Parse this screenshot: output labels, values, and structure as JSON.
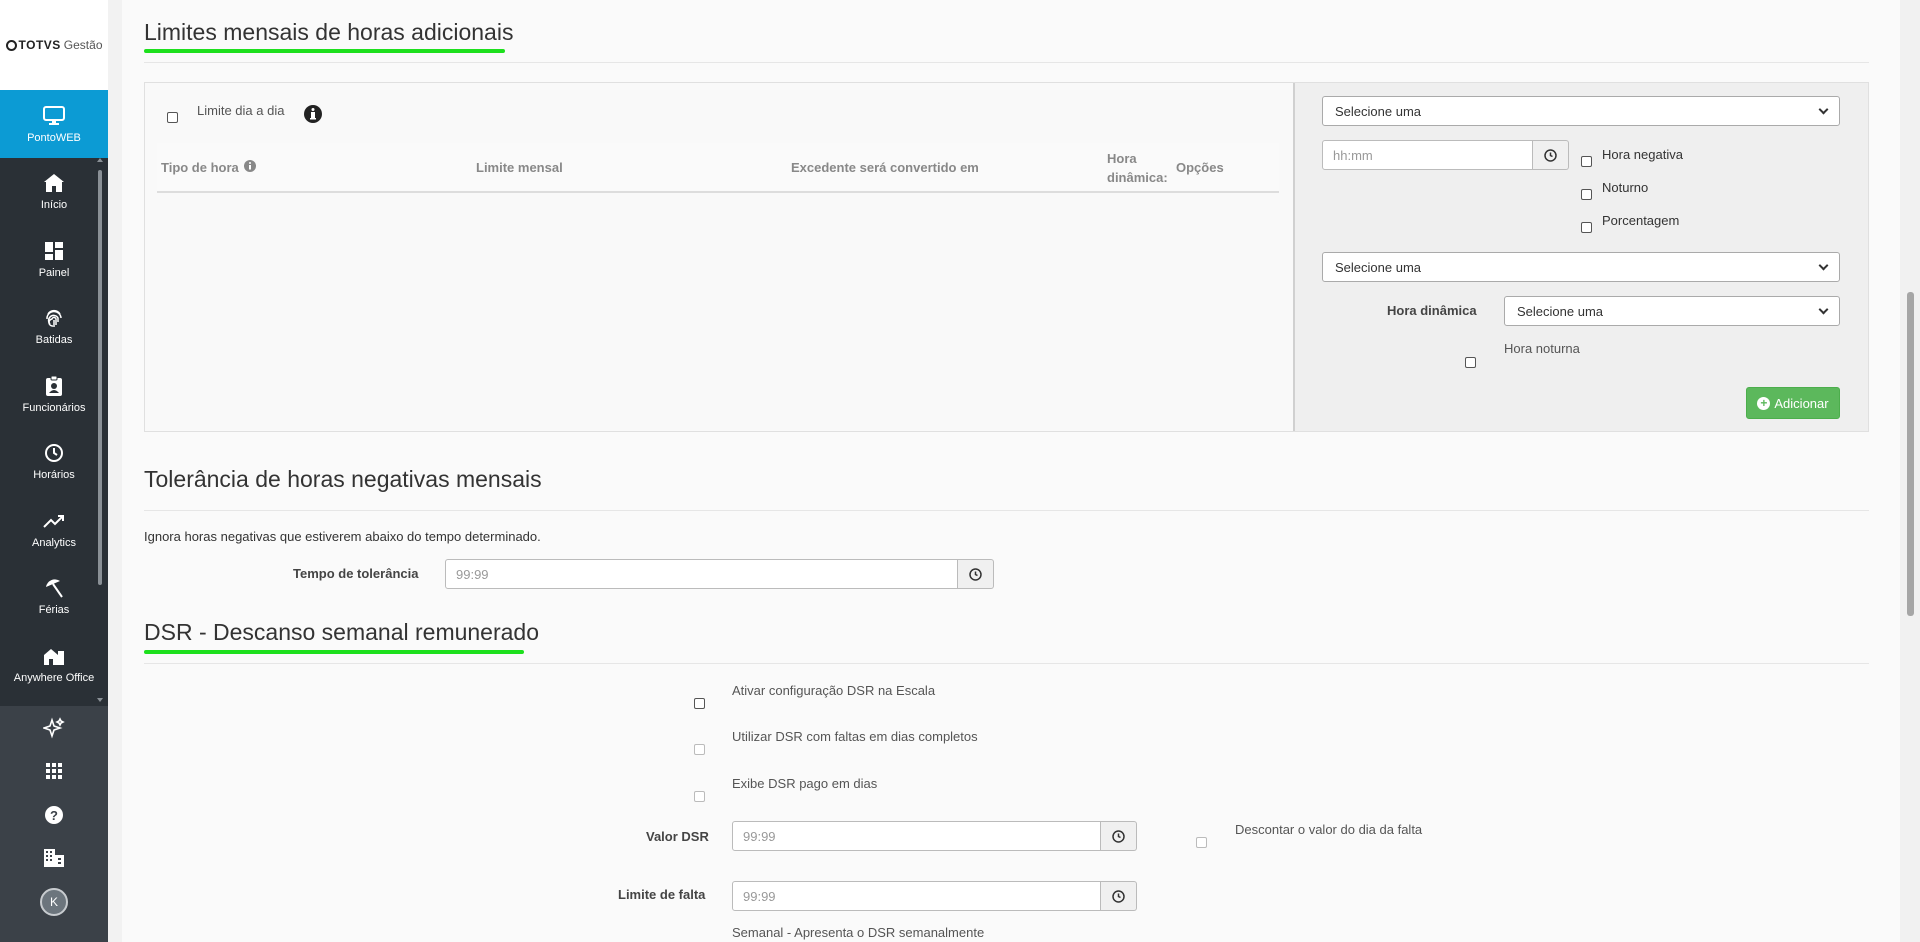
{
  "brand": {
    "name": "TOTVS",
    "product": "Gestão"
  },
  "nav": {
    "items": [
      {
        "label": "PontoWEB",
        "icon": "monitor-icon",
        "active": true
      },
      {
        "label": "Início",
        "icon": "home-icon"
      },
      {
        "label": "Painel",
        "icon": "dashboard-icon"
      },
      {
        "label": "Batidas",
        "icon": "fingerprint-icon"
      },
      {
        "label": "Funcionários",
        "icon": "badge-icon"
      },
      {
        "label": "Horários",
        "icon": "clock-icon"
      },
      {
        "label": "Analytics",
        "icon": "trend-icon"
      },
      {
        "label": "Férias",
        "icon": "beach-umbrella-icon"
      },
      {
        "label": "Anywhere Office",
        "icon": "building-home-icon"
      }
    ],
    "bottom": [
      "sparkle-icon",
      "apps-grid-icon",
      "help-icon",
      "company-icon"
    ],
    "avatar_initial": "K"
  },
  "limits": {
    "title": "Limites mensais de horas adicionais",
    "day_by_day_label": "Limite dia a dia",
    "columns": {
      "tipo": "Tipo de hora",
      "limite": "Limite mensal",
      "excedente": "Excedente será convertido em",
      "hora_dinamica_line1": "Hora",
      "hora_dinamica_line2": "dinâmica:",
      "opcoes": "Opções"
    },
    "form": {
      "select1": "Selecione uma",
      "time_placeholder": "hh:mm",
      "hora_negativa": "Hora negativa",
      "noturno": "Noturno",
      "porcentagem": "Porcentagem",
      "select2": "Selecione uma",
      "hora_dinamica_label": "Hora dinâmica",
      "hora_dinamica_select": "Selecione uma",
      "hora_noturna": "Hora noturna",
      "add_button": "Adicionar"
    }
  },
  "tolerance": {
    "title": "Tolerância de horas negativas mensais",
    "description": "Ignora horas negativas que estiverem abaixo do tempo determinado.",
    "field_label": "Tempo de tolerância",
    "placeholder": "99:99"
  },
  "dsr": {
    "title": "DSR - Descanso semanal remunerado",
    "ativar": "Ativar configuração DSR na Escala",
    "utilizar": "Utilizar DSR com faltas em dias completos",
    "exibe": "Exibe DSR pago em dias",
    "valor_label": "Valor DSR",
    "valor_placeholder": "99:99",
    "descontar": "Descontar o valor do dia da falta",
    "limite_label": "Limite de falta",
    "limite_placeholder": "99:99",
    "semanal": "Semanal - Apresenta o DSR semanalmente"
  },
  "colors": {
    "sidebar": "#2a3036",
    "active": "#0c9bd4",
    "underline": "#1de01d",
    "add_button": "#5cb85c"
  }
}
